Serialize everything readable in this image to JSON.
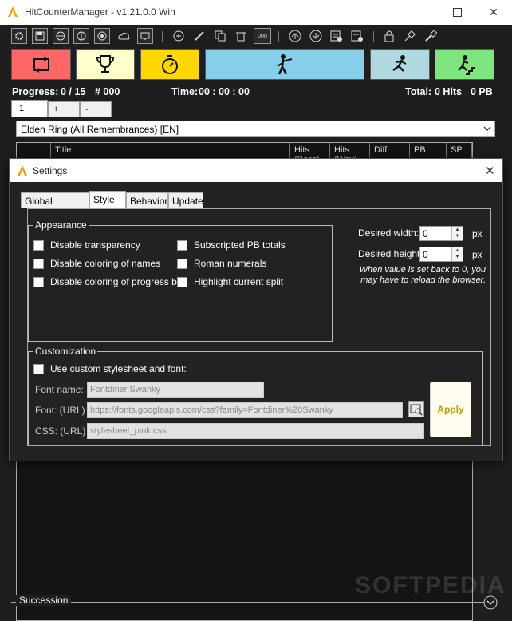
{
  "window": {
    "title": "HitCounterManager - v1.21.0.0 Win",
    "controls": [
      "minimize-icon",
      "maximize-icon",
      "close-icon"
    ]
  },
  "toolbar": {
    "icons": [
      "gear-icon",
      "save-icon",
      "globe-icon",
      "globe-search-icon",
      "globe-settings-icon",
      "cloud-icon",
      "monitor-icon",
      "add-circle-icon",
      "pencil-icon",
      "copy-icon",
      "delete-icon",
      "counter-icon",
      "arrow-up-icon",
      "arrow-down-icon",
      "settings-list-icon",
      "settings-list-x-icon",
      "lock-icon",
      "pin-icon",
      "brush-icon"
    ]
  },
  "action_buttons": [
    {
      "name": "split-swap-button",
      "icon": "repeat-icon",
      "color": "#ff6666"
    },
    {
      "name": "pb-button",
      "icon": "trophy-icon",
      "color": "#ffffcc"
    },
    {
      "name": "timer-button",
      "icon": "stopwatch-icon",
      "color": "#ffd700"
    },
    {
      "name": "hit-button",
      "icon": "hit-figure-icon",
      "color": "#87ceeb"
    },
    {
      "name": "way-hit-button",
      "icon": "running-figure-icon",
      "color": "#b0d8e0"
    },
    {
      "name": "split-button",
      "icon": "stairs-figure-icon",
      "color": "#7fe57f"
    }
  ],
  "status": {
    "progress_label": "Progress:",
    "progress_value": "0 / 15",
    "progress_count": "# 000",
    "time_label": "Time:",
    "time_value": "00 : 00 : 00",
    "total_label": "Total:",
    "total_hits": "0 Hits",
    "total_pb": "0 PB"
  },
  "profile_tabs": [
    "1",
    "+",
    "-"
  ],
  "profile_select": "Elden Ring (All Remembrances) [EN]",
  "columns": [
    "Title",
    "Hits (Boss)",
    "Hits (Way)",
    "Diff",
    "PB",
    "SP"
  ],
  "succession_label": "Succession",
  "watermark": "SOFTPEDIA",
  "settings": {
    "title": "Settings",
    "tabs": [
      "Global shortcuts",
      "Style",
      "Behavior",
      "Update"
    ],
    "active_tab": "Style",
    "appearance": {
      "label": "Appearance",
      "options": [
        {
          "label": "Disable transparency",
          "checked": false
        },
        {
          "label": "Disable coloring of names",
          "checked": false
        },
        {
          "label": "Disable coloring of progress bar",
          "checked": false
        },
        {
          "label": "Subscripted PB totals",
          "checked": false
        },
        {
          "label": "Roman numerals",
          "checked": false
        },
        {
          "label": "Highlight current split",
          "checked": false
        }
      ]
    },
    "desired_width_label": "Desired width:",
    "desired_width": "0",
    "desired_height_label": "Desired height:",
    "desired_height": "0",
    "unit": "px",
    "note": "When value is set back to 0, you may have to reload the browser.",
    "customization": {
      "label": "Customization",
      "use_custom_label": "Use custom stylesheet and font:",
      "use_custom_checked": false,
      "font_name_label": "Font name:",
      "font_name": "Fontdiner Swanky",
      "font_url_label": "Font: (URL)",
      "font_url": "https://fonts.googleapis.com/css?family=Fontdiner%20Swanky",
      "css_url_label": "CSS: (URL)",
      "css_url": "stylesheet_pink.css",
      "apply_label": "Apply"
    }
  }
}
